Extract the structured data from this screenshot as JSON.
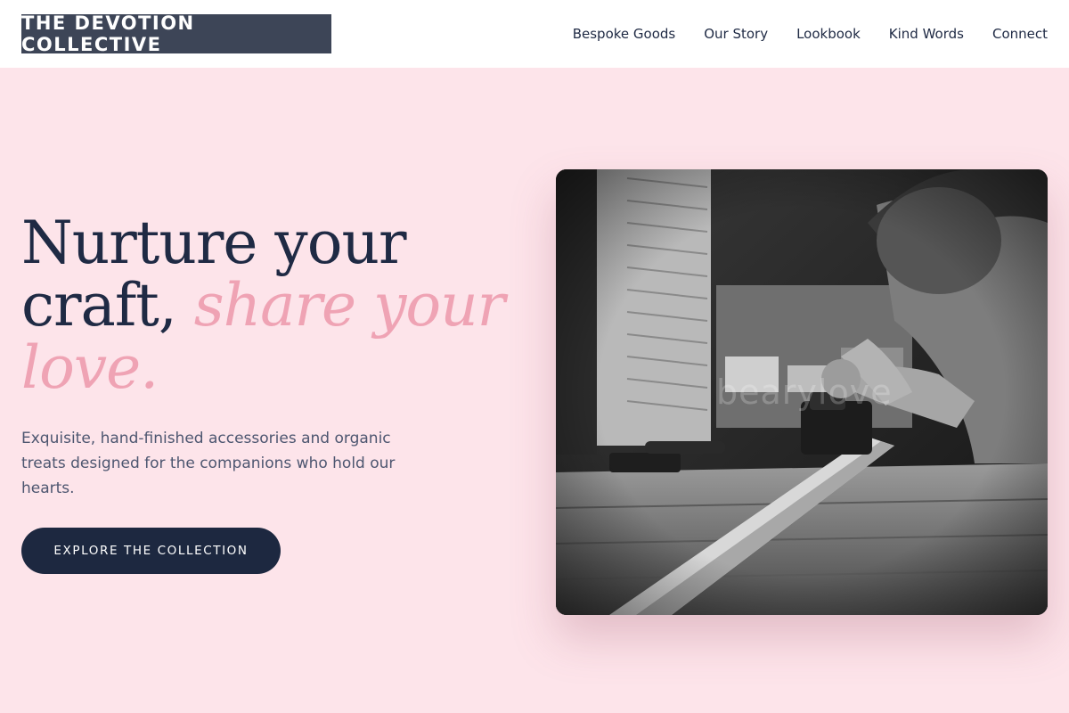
{
  "header": {
    "logo_text": "THE DEVOTION COLLECTIVE",
    "nav": [
      {
        "label": "Bespoke Goods"
      },
      {
        "label": "Our Story"
      },
      {
        "label": "Lookbook"
      },
      {
        "label": "Kind Words"
      },
      {
        "label": "Connect"
      }
    ]
  },
  "hero": {
    "title_line1": "Nurture your",
    "title_line2_plain": "craft,",
    "title_line2_accent": "share your",
    "title_line3_accent": "love.",
    "description": "Exquisite, hand-finished accessories and organic treats designed for the companions who hold our hearts.",
    "cta_label": "EXPLORE THE COLLECTION",
    "image": {
      "watermark": "bearylove"
    }
  },
  "colors": {
    "background": "#fde4ea",
    "header_bg": "#ffffff",
    "logo_bg": "#3d4557",
    "text_dark": "#1f2a44",
    "accent_pink": "#efa3b4",
    "button_bg": "#1d2840"
  }
}
